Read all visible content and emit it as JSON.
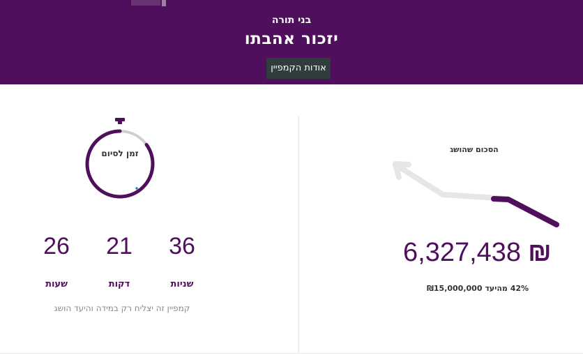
{
  "header": {
    "org_name": "בני תורה",
    "title": "יזכור אהבתו",
    "about_button": "אודות הקמפיין"
  },
  "countdown": {
    "label": "זמן לסיום",
    "ring_progress": 0.85,
    "units": [
      {
        "value": "36",
        "label": "שניות"
      },
      {
        "value": "21",
        "label": "דקות"
      },
      {
        "value": "26",
        "label": "שעות"
      }
    ],
    "note": "קמפיין זה יצליח רק במידה והיעד הושג"
  },
  "raised": {
    "title": "הסכום שהושג",
    "amount": "6,327,438",
    "currency_symbol": "₪",
    "goal_text": "42% מהיעד ₪15,000,000",
    "percent": 42
  },
  "colors": {
    "brand": "#4f0f5c",
    "button": "#2f3d3d",
    "track": "#e6e6e6"
  }
}
